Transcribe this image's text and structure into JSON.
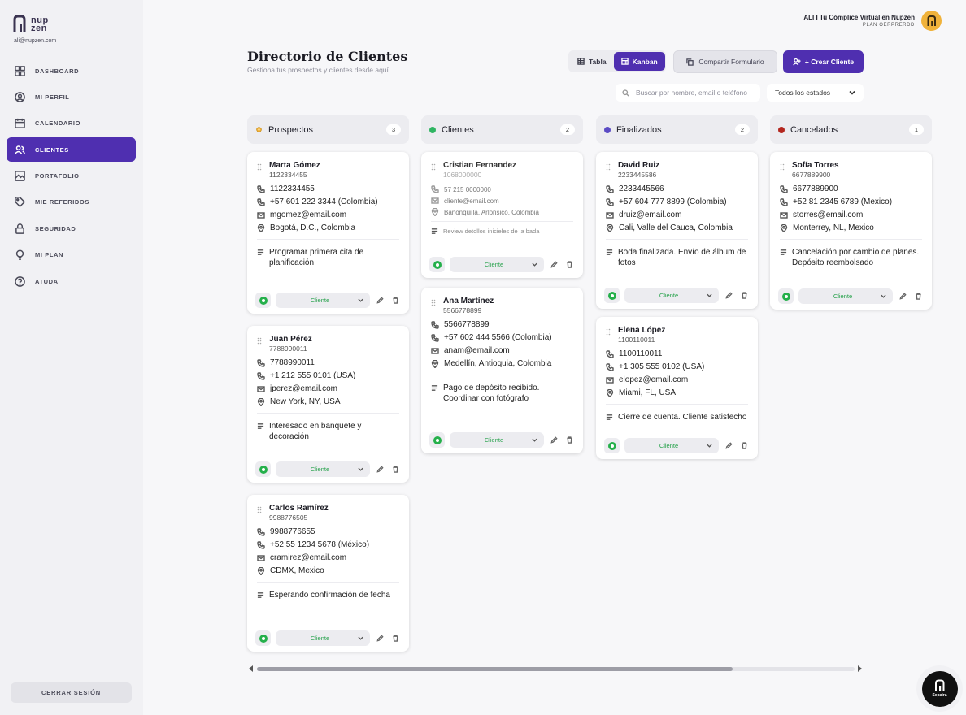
{
  "app": {
    "logo_text_1": "nup",
    "logo_text_2": "zen",
    "user_email": "ali@nupzen.com"
  },
  "colors": {
    "accent": "#4f2fb0",
    "prospectos": "#f0b23a",
    "clientes": "#2fb562",
    "finalizados": "#5b4bc4",
    "cancelados": "#b3261e",
    "whatsapp": "#25b04b"
  },
  "sidebar": {
    "items": [
      {
        "label": "DASHBOARD",
        "icon": "grid-icon"
      },
      {
        "label": "MI PERFIL",
        "icon": "user-circle-icon"
      },
      {
        "label": "CALENDARIO",
        "icon": "calendar-icon"
      },
      {
        "label": "CLIENTES",
        "icon": "users-icon",
        "active": true
      },
      {
        "label": "PORTAFOLIO",
        "icon": "image-icon"
      },
      {
        "label": "MIE REFERIDOS",
        "icon": "tag-icon"
      },
      {
        "label": "SEGURIDAD",
        "icon": "lock-icon"
      },
      {
        "label": "MI PLAN",
        "icon": "lightbulb-icon"
      },
      {
        "label": "ATUDA",
        "icon": "help-circle-icon"
      }
    ],
    "logout_label": "CERRAR SESIÓN"
  },
  "topbar": {
    "user_line": "ALI I Tu Cómplice Virtual en Nupzen",
    "plan_line": "PLAN OERPRERDD"
  },
  "header": {
    "title": "Directorio de Clientes",
    "subtitle": "Gestiona tus prospectos y clientes desde aquí."
  },
  "toolbar": {
    "view_table": "Tabla",
    "view_kanban": "Kanban",
    "share_label": "Compartir Formulario",
    "create_label": "+ Crear Cliente",
    "search_placeholder": "Buscar por nombre, email o teléfono",
    "status_filter": "Todos los estados"
  },
  "columns": [
    {
      "title": "Prospectos",
      "count": "3",
      "cards": [
        {
          "name": "Marta Gómez",
          "id": "1122334455",
          "phone": "1122334455",
          "phone_intl": "+57 601 222 3344 (Colombia)",
          "email": "mgomez@email.com",
          "location": "Bogotá, D.C., Colombia",
          "note": "Programar primera cita de planificación",
          "status": "Cliente"
        },
        {
          "name": "Juan Pérez",
          "id": "7788990011",
          "phone": "7788990011",
          "phone_intl": "+1 212 555 0101 (USA)",
          "email": "jperez@email.com",
          "location": "New York, NY, USA",
          "note": "Interesado en banquete y decoración",
          "status": "Cliente"
        },
        {
          "name": "Carlos Ramírez",
          "id": "9988776505",
          "phone": "9988776655",
          "phone_intl": "+52 55 1234 5678 (México)",
          "email": "cramirez@email.com",
          "location": "CDMX, Mexico",
          "note": "Esperando confirmación de fecha",
          "status": "Cliente"
        }
      ]
    },
    {
      "title": "Clientes",
      "count": "2",
      "cards": [
        {
          "name": "Cristian Fernandez",
          "id": "1068000000",
          "phone_intl": "57 215 0000000",
          "email": "cliente@email.com",
          "location": "Banonquilla, Arlonsico, Colombia",
          "note": "Review detollos inicieles de la bada",
          "status": "Cliente"
        },
        {
          "name": "Ana Martínez",
          "id": "5566778899",
          "phone": "5566778899",
          "phone_intl": "+57 602 444 5566 (Colombia)",
          "email": "anam@email.com",
          "location": "Medellín, Antioquia, Colombia",
          "note": "Pago de depósito recibido. Coordinar con fotógrafo",
          "status": "Cliente"
        }
      ]
    },
    {
      "title": "Finalizados",
      "count": "2",
      "cards": [
        {
          "name": "David Ruiz",
          "id": "2233445586",
          "phone": "2233445566",
          "phone_intl": "+57 604 777 8899 (Colombia)",
          "email": "druiz@email.com",
          "location": "Cali, Valle del Cauca, Colombia",
          "note": "Boda finalizada. Envío de álbum de fotos",
          "status": "Cliente"
        },
        {
          "name": "Elena López",
          "id": "1100110011",
          "phone": "1100110011",
          "phone_intl": "+1 305 555 0102 (USA)",
          "email": "elopez@email.com",
          "location": "Miami, FL, USA",
          "note": "Cierre de cuenta. Cliente satisfecho",
          "status": "Cliente"
        }
      ]
    },
    {
      "title": "Cancelados",
      "count": "1",
      "cards": [
        {
          "name": "Sofía Torres",
          "id": "6677889900",
          "phone": "6677889900",
          "phone_intl": "+52 81 2345 6789 (Mexico)",
          "email": "storres@email.com",
          "location": "Monterrey, NL, Mexico",
          "note": "Cancelación por cambio de planes. Depósito reembolsado",
          "status": "Cliente"
        }
      ]
    }
  ],
  "badge": {
    "label": "Sepaira"
  }
}
